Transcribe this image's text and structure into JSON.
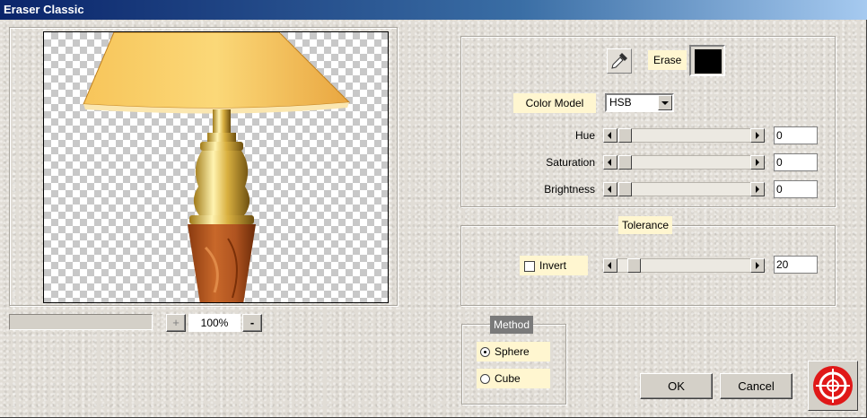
{
  "window": {
    "title": "Eraser Classic"
  },
  "preview": {
    "zoom": "100%",
    "zoom_in": "+",
    "zoom_out": "-"
  },
  "erase": {
    "label": "Erase",
    "color": "#000000"
  },
  "color_model": {
    "label": "Color Model",
    "value": "HSB"
  },
  "sliders": {
    "hue": {
      "label": "Hue",
      "value": "0"
    },
    "saturation": {
      "label": "Saturation",
      "value": "0"
    },
    "brightness": {
      "label": "Brightness",
      "value": "0"
    }
  },
  "tolerance": {
    "title": "Tolerance",
    "invert_label": "Invert",
    "invert_checked": false,
    "value": "20"
  },
  "method": {
    "title": "Method",
    "options": [
      "Sphere",
      "Cube"
    ],
    "selected": "Sphere"
  },
  "buttons": {
    "ok": "OK",
    "cancel": "Cancel"
  }
}
